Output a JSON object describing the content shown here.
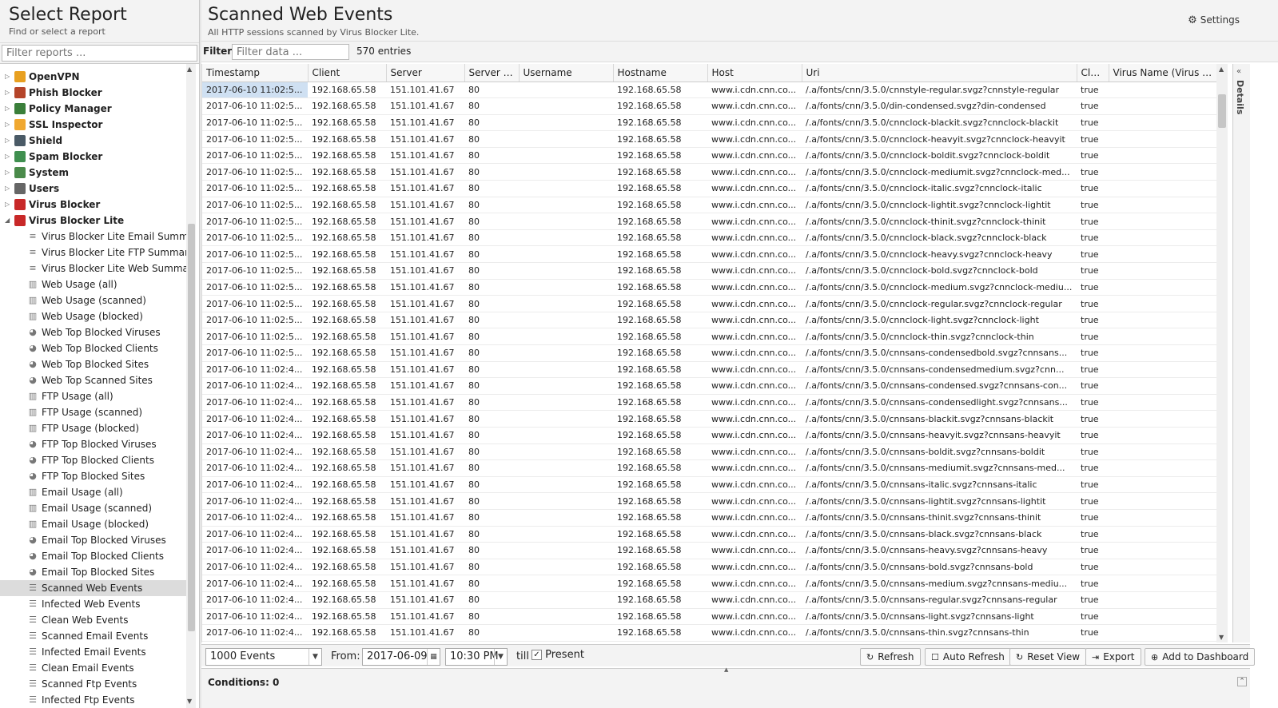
{
  "left": {
    "title": "Select Report",
    "subtitle": "Find or select a report",
    "filter_placeholder": "Filter reports ..."
  },
  "tree": {
    "categories": [
      {
        "label": "OpenVPN",
        "icon": "openvpn-icon",
        "color": "#e8a020"
      },
      {
        "label": "Phish Blocker",
        "icon": "phish-blocker-icon",
        "color": "#b5452a"
      },
      {
        "label": "Policy Manager",
        "icon": "policy-manager-icon",
        "color": "#3a7f3a"
      },
      {
        "label": "SSL Inspector",
        "icon": "ssl-inspector-icon",
        "color": "#f0a830"
      },
      {
        "label": "Shield",
        "icon": "shield-icon",
        "color": "#4a5a66"
      },
      {
        "label": "Spam Blocker",
        "icon": "spam-blocker-icon",
        "color": "#3f8f4f"
      },
      {
        "label": "System",
        "icon": "system-icon",
        "color": "#4a8a4a"
      },
      {
        "label": "Users",
        "icon": "users-icon",
        "color": "#666666"
      },
      {
        "label": "Virus Blocker",
        "icon": "virus-blocker-icon",
        "color": "#c82828"
      },
      {
        "label": "Virus Blocker Lite",
        "icon": "virus-blocker-lite-icon",
        "color": "#c82828"
      }
    ],
    "expanded_leaves": [
      {
        "label": "Virus Blocker Lite Email Summary",
        "icon": "list-icon"
      },
      {
        "label": "Virus Blocker Lite FTP Summary",
        "icon": "list-icon"
      },
      {
        "label": "Virus Blocker Lite Web Summary",
        "icon": "list-icon"
      },
      {
        "label": "Web Usage (all)",
        "icon": "bar-chart-icon"
      },
      {
        "label": "Web Usage (scanned)",
        "icon": "bar-chart-icon"
      },
      {
        "label": "Web Usage (blocked)",
        "icon": "bar-chart-icon"
      },
      {
        "label": "Web Top Blocked Viruses",
        "icon": "pie-chart-icon"
      },
      {
        "label": "Web Top Blocked Clients",
        "icon": "pie-chart-icon"
      },
      {
        "label": "Web Top Blocked Sites",
        "icon": "pie-chart-icon"
      },
      {
        "label": "Web Top Scanned Sites",
        "icon": "pie-chart-icon"
      },
      {
        "label": "FTP Usage (all)",
        "icon": "bar-chart-icon"
      },
      {
        "label": "FTP Usage (scanned)",
        "icon": "bar-chart-icon"
      },
      {
        "label": "FTP Usage (blocked)",
        "icon": "bar-chart-icon"
      },
      {
        "label": "FTP Top Blocked Viruses",
        "icon": "pie-chart-icon"
      },
      {
        "label": "FTP Top Blocked Clients",
        "icon": "pie-chart-icon"
      },
      {
        "label": "FTP Top Blocked Sites",
        "icon": "pie-chart-icon"
      },
      {
        "label": "Email Usage (all)",
        "icon": "bar-chart-icon"
      },
      {
        "label": "Email Usage (scanned)",
        "icon": "bar-chart-icon"
      },
      {
        "label": "Email Usage (blocked)",
        "icon": "bar-chart-icon"
      },
      {
        "label": "Email Top Blocked Viruses",
        "icon": "pie-chart-icon"
      },
      {
        "label": "Email Top Blocked Clients",
        "icon": "pie-chart-icon"
      },
      {
        "label": "Email Top Blocked Sites",
        "icon": "pie-chart-icon"
      },
      {
        "label": "Scanned Web Events",
        "icon": "event-list-icon",
        "selected": true
      },
      {
        "label": "Infected Web Events",
        "icon": "event-list-icon"
      },
      {
        "label": "Clean Web Events",
        "icon": "event-list-icon"
      },
      {
        "label": "Scanned Email Events",
        "icon": "event-list-icon"
      },
      {
        "label": "Infected Email Events",
        "icon": "event-list-icon"
      },
      {
        "label": "Clean Email Events",
        "icon": "event-list-icon"
      },
      {
        "label": "Scanned Ftp Events",
        "icon": "event-list-icon"
      },
      {
        "label": "Infected Ftp Events",
        "icon": "event-list-icon"
      }
    ]
  },
  "report": {
    "title": "Scanned Web Events",
    "subtitle": "All HTTP sessions scanned by Virus Blocker Lite.",
    "settings_label": "Settings",
    "filter_label": "Filter:",
    "filter_placeholder": "Filter data ...",
    "entries": "570 entries",
    "details_label": "Details"
  },
  "grid": {
    "columns": [
      "Timestamp",
      "Client",
      "Server",
      "Server P...",
      "Username",
      "Hostname",
      "Host",
      "Uri",
      "Cle...",
      "Virus Name (Virus B..."
    ],
    "common": {
      "client": "192.168.65.58",
      "server": "151.101.41.67",
      "port": "80",
      "username": "",
      "hostname": "192.168.65.58",
      "host": "www.i.cdn.cnn.co...",
      "clean": "true",
      "virus": ""
    },
    "rows": [
      {
        "ts": "2017-06-10 11:02:5...",
        "uri": "/.a/fonts/cnn/3.5.0/cnnstyle-regular.svgz?cnnstyle-regular"
      },
      {
        "ts": "2017-06-10 11:02:5...",
        "uri": "/.a/fonts/cnn/3.5.0/din-condensed.svgz?din-condensed"
      },
      {
        "ts": "2017-06-10 11:02:5...",
        "uri": "/.a/fonts/cnn/3.5.0/cnnclock-blackit.svgz?cnnclock-blackit"
      },
      {
        "ts": "2017-06-10 11:02:5...",
        "uri": "/.a/fonts/cnn/3.5.0/cnnclock-heavyit.svgz?cnnclock-heavyit"
      },
      {
        "ts": "2017-06-10 11:02:5...",
        "uri": "/.a/fonts/cnn/3.5.0/cnnclock-boldit.svgz?cnnclock-boldit"
      },
      {
        "ts": "2017-06-10 11:02:5...",
        "uri": "/.a/fonts/cnn/3.5.0/cnnclock-mediumit.svgz?cnnclock-med..."
      },
      {
        "ts": "2017-06-10 11:02:5...",
        "uri": "/.a/fonts/cnn/3.5.0/cnnclock-italic.svgz?cnnclock-italic"
      },
      {
        "ts": "2017-06-10 11:02:5...",
        "uri": "/.a/fonts/cnn/3.5.0/cnnclock-lightit.svgz?cnnclock-lightit"
      },
      {
        "ts": "2017-06-10 11:02:5...",
        "uri": "/.a/fonts/cnn/3.5.0/cnnclock-thinit.svgz?cnnclock-thinit"
      },
      {
        "ts": "2017-06-10 11:02:5...",
        "uri": "/.a/fonts/cnn/3.5.0/cnnclock-black.svgz?cnnclock-black"
      },
      {
        "ts": "2017-06-10 11:02:5...",
        "uri": "/.a/fonts/cnn/3.5.0/cnnclock-heavy.svgz?cnnclock-heavy"
      },
      {
        "ts": "2017-06-10 11:02:5...",
        "uri": "/.a/fonts/cnn/3.5.0/cnnclock-bold.svgz?cnnclock-bold"
      },
      {
        "ts": "2017-06-10 11:02:5...",
        "uri": "/.a/fonts/cnn/3.5.0/cnnclock-medium.svgz?cnnclock-mediu..."
      },
      {
        "ts": "2017-06-10 11:02:5...",
        "uri": "/.a/fonts/cnn/3.5.0/cnnclock-regular.svgz?cnnclock-regular"
      },
      {
        "ts": "2017-06-10 11:02:5...",
        "uri": "/.a/fonts/cnn/3.5.0/cnnclock-light.svgz?cnnclock-light"
      },
      {
        "ts": "2017-06-10 11:02:5...",
        "uri": "/.a/fonts/cnn/3.5.0/cnnclock-thin.svgz?cnnclock-thin"
      },
      {
        "ts": "2017-06-10 11:02:5...",
        "uri": "/.a/fonts/cnn/3.5.0/cnnsans-condensedbold.svgz?cnnsans..."
      },
      {
        "ts": "2017-06-10 11:02:4...",
        "uri": "/.a/fonts/cnn/3.5.0/cnnsans-condensedmedium.svgz?cnn..."
      },
      {
        "ts": "2017-06-10 11:02:4...",
        "uri": "/.a/fonts/cnn/3.5.0/cnnsans-condensed.svgz?cnnsans-con..."
      },
      {
        "ts": "2017-06-10 11:02:4...",
        "uri": "/.a/fonts/cnn/3.5.0/cnnsans-condensedlight.svgz?cnnsans..."
      },
      {
        "ts": "2017-06-10 11:02:4...",
        "uri": "/.a/fonts/cnn/3.5.0/cnnsans-blackit.svgz?cnnsans-blackit"
      },
      {
        "ts": "2017-06-10 11:02:4...",
        "uri": "/.a/fonts/cnn/3.5.0/cnnsans-heavyit.svgz?cnnsans-heavyit"
      },
      {
        "ts": "2017-06-10 11:02:4...",
        "uri": "/.a/fonts/cnn/3.5.0/cnnsans-boldit.svgz?cnnsans-boldit"
      },
      {
        "ts": "2017-06-10 11:02:4...",
        "uri": "/.a/fonts/cnn/3.5.0/cnnsans-mediumit.svgz?cnnsans-med..."
      },
      {
        "ts": "2017-06-10 11:02:4...",
        "uri": "/.a/fonts/cnn/3.5.0/cnnsans-italic.svgz?cnnsans-italic"
      },
      {
        "ts": "2017-06-10 11:02:4...",
        "uri": "/.a/fonts/cnn/3.5.0/cnnsans-lightit.svgz?cnnsans-lightit"
      },
      {
        "ts": "2017-06-10 11:02:4...",
        "uri": "/.a/fonts/cnn/3.5.0/cnnsans-thinit.svgz?cnnsans-thinit"
      },
      {
        "ts": "2017-06-10 11:02:4...",
        "uri": "/.a/fonts/cnn/3.5.0/cnnsans-black.svgz?cnnsans-black"
      },
      {
        "ts": "2017-06-10 11:02:4...",
        "uri": "/.a/fonts/cnn/3.5.0/cnnsans-heavy.svgz?cnnsans-heavy"
      },
      {
        "ts": "2017-06-10 11:02:4...",
        "uri": "/.a/fonts/cnn/3.5.0/cnnsans-bold.svgz?cnnsans-bold"
      },
      {
        "ts": "2017-06-10 11:02:4...",
        "uri": "/.a/fonts/cnn/3.5.0/cnnsans-medium.svgz?cnnsans-mediu..."
      },
      {
        "ts": "2017-06-10 11:02:4...",
        "uri": "/.a/fonts/cnn/3.5.0/cnnsans-regular.svgz?cnnsans-regular"
      },
      {
        "ts": "2017-06-10 11:02:4...",
        "uri": "/.a/fonts/cnn/3.5.0/cnnsans-light.svgz?cnnsans-light"
      },
      {
        "ts": "2017-06-10 11:02:4...",
        "uri": "/.a/fonts/cnn/3.5.0/cnnsans-thin.svgz?cnnsans-thin"
      }
    ]
  },
  "bottom": {
    "limit_value": "1000 Events",
    "from_label": "From:",
    "from_date": "2017-06-09",
    "from_time": "10:30 PM",
    "till_label": "till",
    "present_label": "Present",
    "present_checked": true,
    "refresh_label": "Refresh",
    "auto_refresh_label": "Auto Refresh",
    "reset_view_label": "Reset View",
    "export_label": "Export",
    "add_dashboard_label": "Add to Dashboard",
    "conditions_label": "Conditions: 0"
  }
}
